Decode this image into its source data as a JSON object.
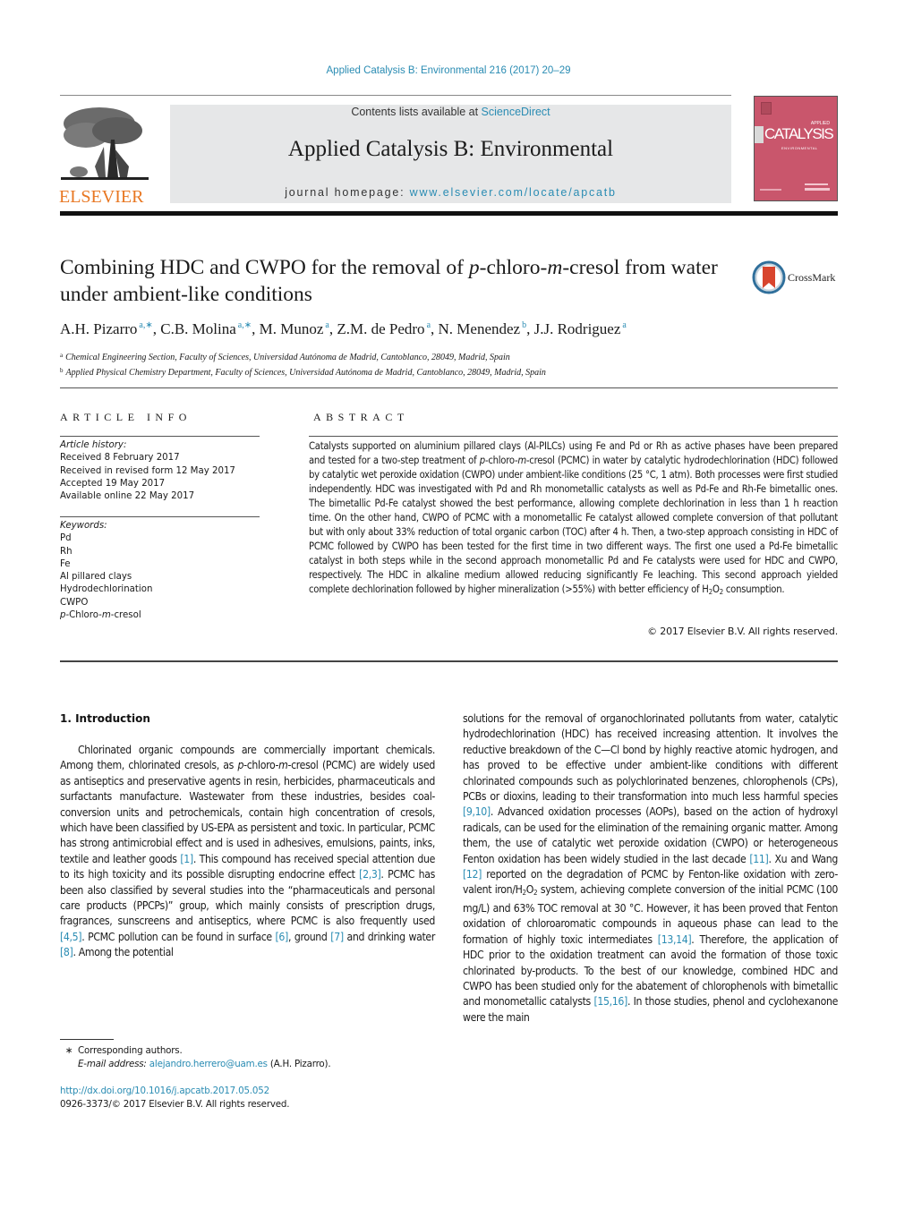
{
  "header": {
    "journal_ref": "Applied Catalysis B: Environmental 216 (2017) 20–29",
    "contents_prefix": "Contents lists available at ",
    "contents_link": "ScienceDirect",
    "journal_title": "Applied Catalysis B: Environmental",
    "homepage_prefix": "journal homepage: ",
    "homepage_link": "www.elsevier.com/locate/apcatb",
    "publisher_logo_text": "ELSEVIER",
    "cover": {
      "word_main": "CATALYSIS",
      "word_applied": "APPLIED",
      "word_env": "ENVIRONMENTAL",
      "color": "#c9566c"
    },
    "brand_color": "#e87722",
    "link_color": "#2a8cb3"
  },
  "article": {
    "title_part1": "Combining HDC and CWPO for the removal of ",
    "title_p": "p",
    "title_mid": "-chloro-",
    "title_m": "m",
    "title_part2": "-cresol from water under ambient-like conditions",
    "crossmark_label": "CrossMark",
    "authors": [
      {
        "name": "A.H. Pizarro",
        "sup": "a,∗"
      },
      {
        "name": "C.B. Molina",
        "sup": "a,∗"
      },
      {
        "name": "M. Munoz",
        "sup": "a"
      },
      {
        "name": "Z.M. de Pedro",
        "sup": "a"
      },
      {
        "name": "N. Menendez",
        "sup": "b"
      },
      {
        "name": "J.J. Rodriguez",
        "sup": "a"
      }
    ],
    "affiliations": [
      {
        "key": "a",
        "text": "Chemical Engineering Section, Faculty of Sciences, Universidad Autónoma de Madrid, Cantoblanco, 28049, Madrid, Spain"
      },
      {
        "key": "b",
        "text": "Applied Physical Chemistry Department, Faculty of Sciences, Universidad Autónoma de Madrid, Cantoblanco, 28049, Madrid, Spain"
      }
    ]
  },
  "article_info": {
    "heading": "ARTICLE INFO",
    "history_label": "Article history:",
    "history": [
      "Received 8 February 2017",
      "Received in revised form 12 May 2017",
      "Accepted 19 May 2017",
      "Available online 22 May 2017"
    ],
    "keywords_label": "Keywords:",
    "keywords": [
      "Pd",
      "Rh",
      "Fe",
      "Al pillared clays",
      "Hydrodechlorination",
      "CWPO"
    ],
    "keyword_last": {
      "p": "p",
      "mid": "-Chloro-",
      "m": "m",
      "end": "-cresol"
    }
  },
  "abstract": {
    "heading": "ABSTRACT",
    "s1": "Catalysts supported on aluminium pillared clays (Al-PILCs) using Fe and Pd or Rh as active phases have been prepared and tested for a two-step treatment of ",
    "p": "p",
    "s2": "-chloro-",
    "m": "m",
    "s3": "-cresol (PCMC) in water by catalytic hydrodechlorination (HDC) followed by catalytic wet peroxide oxidation (CWPO) under ambient-like conditions (25 °C, 1 atm). Both processes were first studied independently. HDC was investigated with Pd and Rh monometallic catalysts as well as Pd-Fe and Rh-Fe bimetallic ones. The bimetallic Pd-Fe catalyst showed the best performance, allowing complete dechlorination in less than 1 h reaction time. On the other hand, CWPO of PCMC with a monometallic Fe catalyst allowed complete conversion of that pollutant but with only about 33% reduction of total organic carbon (TOC) after 4 h. Then, a two-step approach consisting in HDC of PCMC followed by CWPO has been tested for the first time in two different ways. The first one used a Pd-Fe bimetallic catalyst in both steps while in the second approach monometallic Pd and Fe catalysts were used for HDC and CWPO, respectively. The HDC in alkaline medium allowed reducing significantly Fe leaching. This second approach yielded complete dechlorination followed by higher mineralization (>55%) with better efficiency of H",
    "sub2a": "2",
    "o": "O",
    "sub2b": "2",
    "s4": " consumption.",
    "copyright": "© 2017 Elsevier B.V. All rights reserved."
  },
  "intro": {
    "heading": "1.  Introduction",
    "left": {
      "t1": "Chlorinated organic compounds are commercially important chemicals. Among them, chlorinated cresols, as ",
      "p": "p",
      "t2": "-chloro-",
      "m": "m",
      "t3": "-cresol (PCMC) are widely used as antiseptics and preservative agents in resin, herbicides, pharmaceuticals and surfactants manufacture. Wastewater from these industries, besides coal-conversion units and petrochemicals, contain high concentration of cresols, which have been classified by US-EPA as persistent and toxic. In particular, PCMC has strong antimicrobial effect and is used in adhesives, emulsions, paints, inks, textile and leather goods ",
      "c1": "[1]",
      "t4": ". This compound has received special attention due to its high toxicity and its possible disrupting endocrine effect ",
      "c2": "[2,3]",
      "t5": ". PCMC has been also classified by several studies into the “pharmaceuticals and personal care products (PPCPs)” group, which mainly consists of prescription drugs, fragrances, sunscreens and antiseptics, where PCMC is also frequently used ",
      "c3": "[4,5]",
      "t6": ". PCMC pollution can be found in surface ",
      "c4": "[6]",
      "t7": ", ground ",
      "c5": "[7]",
      "t8": " and drinking water ",
      "c6": "[8]",
      "t9": ". Among the potential"
    },
    "right": {
      "t1": "solutions for the removal of organochlorinated pollutants from water, catalytic hydrodechlorination (HDC) has received increasing attention. It involves the reductive breakdown of the C—Cl bond by highly reactive atomic hydrogen, and has proved to be effective under ambient-like conditions with different chlorinated compounds such as polychlorinated benzenes, chlorophenols (CPs), PCBs or dioxins, leading to their transformation into much less harmful species ",
      "c1": "[9,10]",
      "t2": ". Advanced oxidation processes (AOPs), based on the action of hydroxyl radicals, can be used for the elimination of the remaining organic matter. Among them, the use of catalytic wet peroxide oxidation (CWPO) or heterogeneous Fenton oxidation has been widely studied in the last decade ",
      "c2": "[11]",
      "t3": ". Xu and Wang ",
      "c3": "[12]",
      "t4": " reported on the degradation of PCMC by Fenton-like oxidation with zero-valent iron/H",
      "sub2a": "2",
      "o": "O",
      "sub2b": "2",
      "t5": " system, achieving complete conversion of the initial PCMC (100 mg/L) and 63% TOC removal at 30 °C. However, it has been proved that Fenton oxidation of chloroaromatic compounds in aqueous phase can lead to the formation of highly toxic intermediates ",
      "c4": "[13,14]",
      "t6": ". Therefore, the application of HDC prior to the oxidation treatment can avoid the formation of those toxic chlorinated by-products. To the best of our knowledge, combined HDC and CWPO has been studied only for the abatement of chlorophenols with bimetallic and monometallic catalysts ",
      "c5": "[15,16]",
      "t7": ". In those studies, phenol and cyclohexanone were the main"
    }
  },
  "footnote": {
    "star": "∗",
    "corresponding": "Corresponding authors.",
    "email_label": "E-mail address:",
    "email": "alejandro.herrero@uam.es",
    "email_suffix": " (A.H. Pizarro).",
    "doi": "http://dx.doi.org/10.1016/j.apcatb.2017.05.052",
    "issn_copyright": "0926-3373/© 2017 Elsevier B.V. All rights reserved."
  }
}
